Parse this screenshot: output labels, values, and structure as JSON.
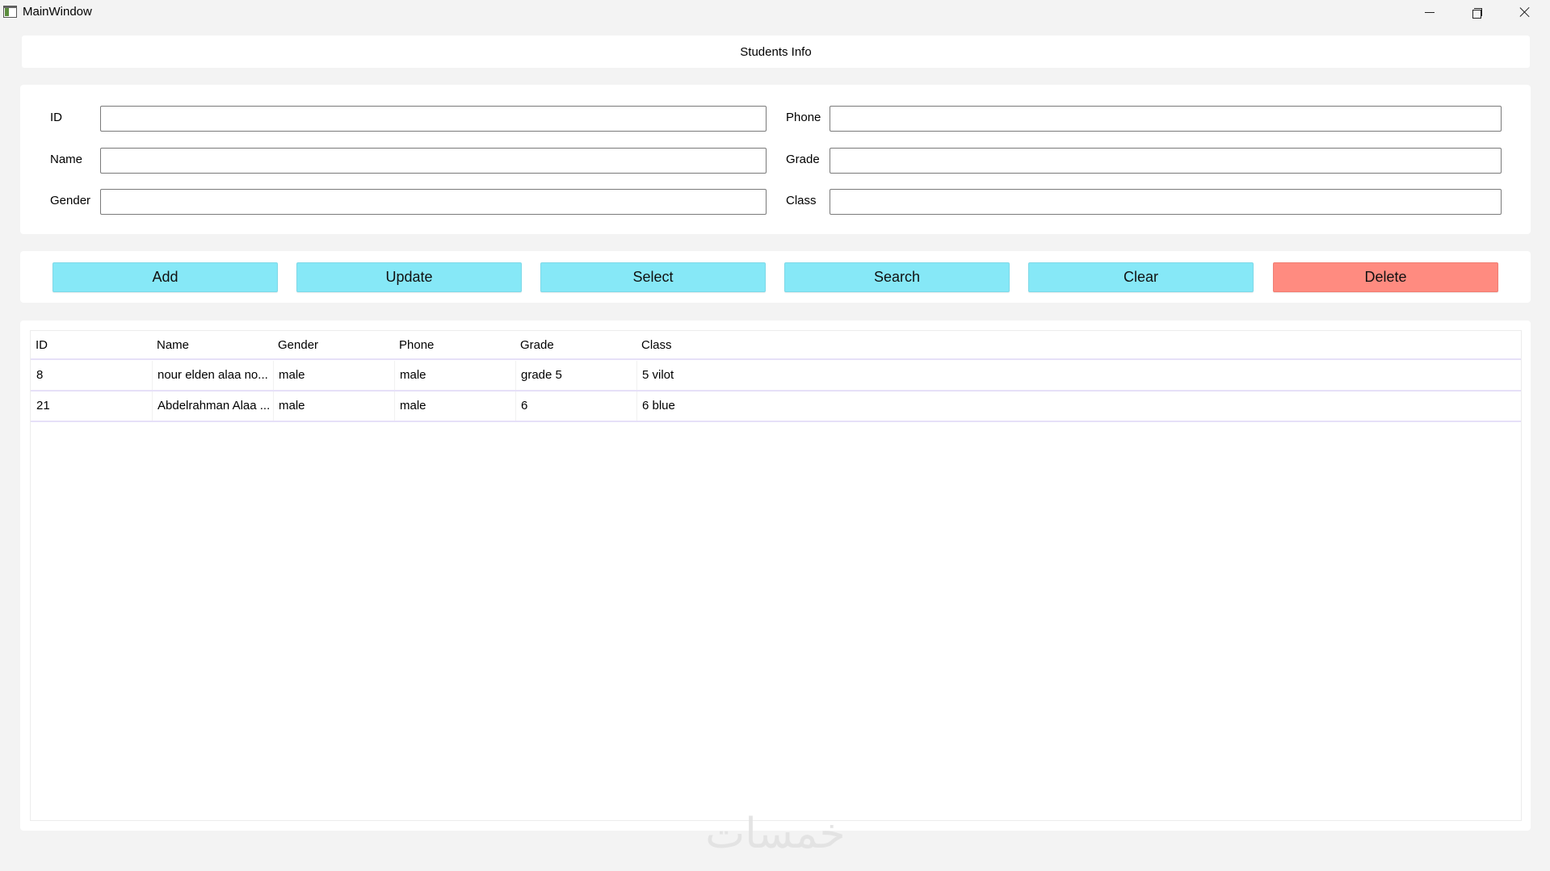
{
  "window": {
    "title": "MainWindow"
  },
  "header": {
    "title": "Students Info"
  },
  "form": {
    "left": [
      {
        "label": "ID",
        "value": ""
      },
      {
        "label": "Name",
        "value": ""
      },
      {
        "label": "Gender",
        "value": ""
      }
    ],
    "right": [
      {
        "label": "Phone",
        "value": ""
      },
      {
        "label": "Grade",
        "value": ""
      },
      {
        "label": "Class",
        "value": ""
      }
    ]
  },
  "actions": [
    {
      "label": "Add"
    },
    {
      "label": "Update"
    },
    {
      "label": "Select"
    },
    {
      "label": "Search"
    },
    {
      "label": "Clear"
    },
    {
      "label": "Delete"
    }
  ],
  "colors": {
    "action_button": "#86e8f7",
    "delete_button": "#ff8b80",
    "row_divider": "#e6e0f8"
  },
  "table": {
    "columns": [
      "ID",
      "Name",
      "Gender",
      "Phone",
      "Grade",
      "Class"
    ],
    "rows": [
      [
        "8",
        "nour elden alaa no...",
        "male",
        "male",
        "grade 5",
        "5 vilot"
      ],
      [
        "21",
        "Abdelrahman Alaa ...",
        "male",
        "male",
        "6",
        "6 blue"
      ]
    ]
  },
  "watermark": {
    "text": "خمسات"
  },
  "icons": {
    "app": "app-window-icon",
    "minimize": "minimize-icon",
    "maximize": "restore-icon",
    "close": "close-icon"
  }
}
